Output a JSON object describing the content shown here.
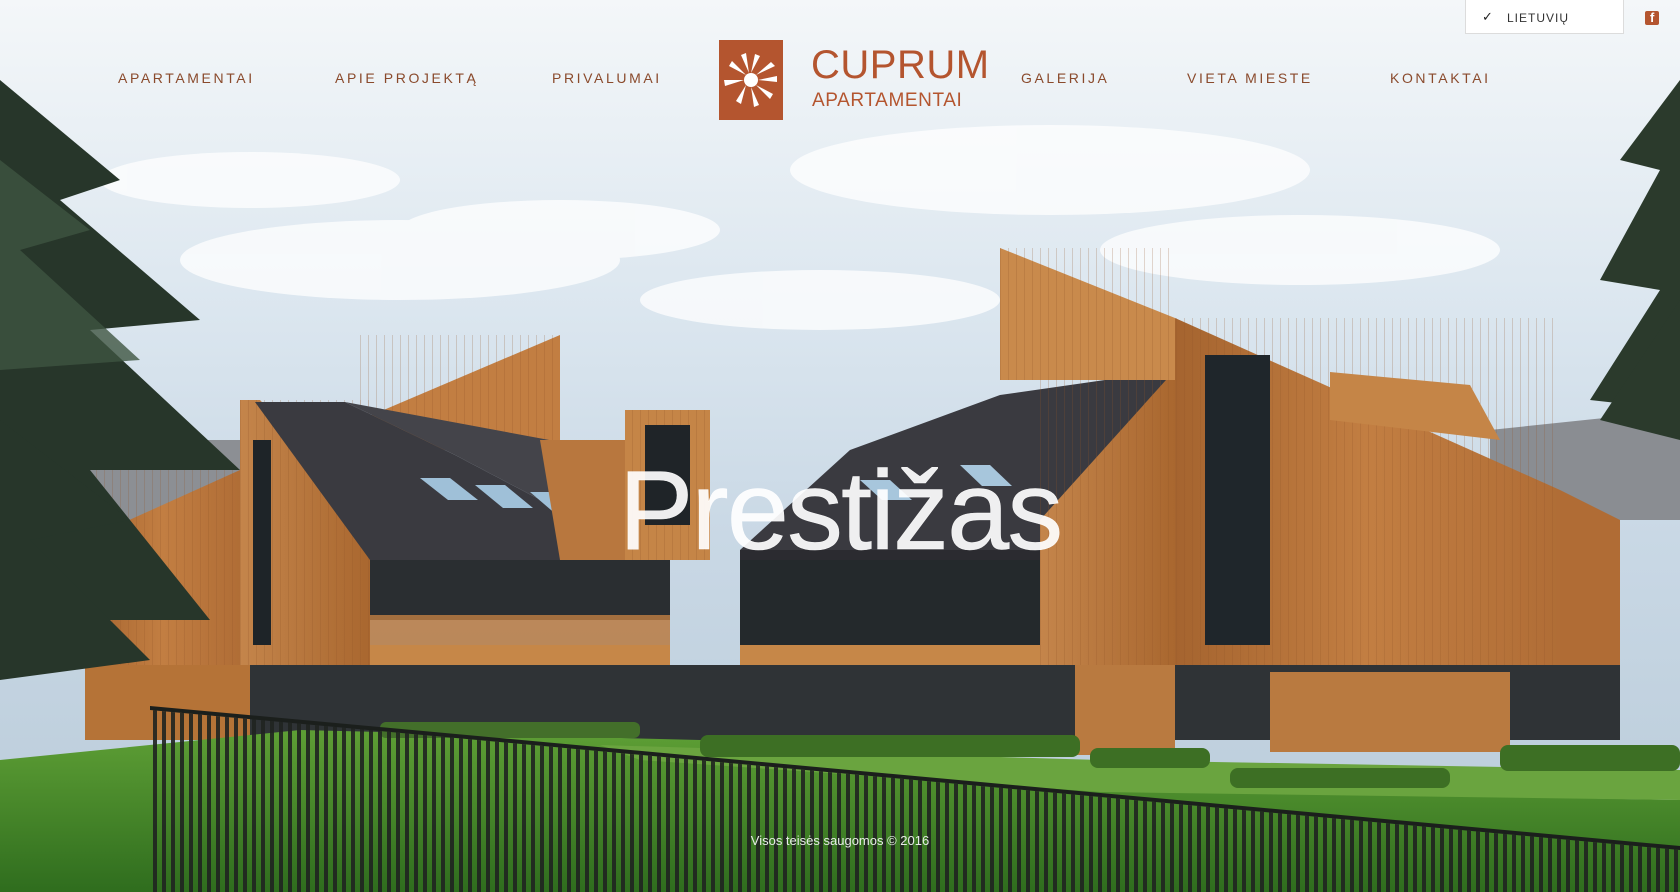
{
  "nav": {
    "left": [
      "APARTAMENTAI",
      "APIE PROJEKTĄ",
      "PRIVALUMAI"
    ],
    "right": [
      "GALERIJA",
      "VIETA MIESTE",
      "KONTAKTAI"
    ]
  },
  "logo": {
    "line1": "CUPRUM",
    "line2": "APARTAMENTAI"
  },
  "language": {
    "check": "✓",
    "selected": "LIETUVIŲ"
  },
  "social": {
    "facebook_icon": "f"
  },
  "hero": {
    "title": "Prestižas"
  },
  "footer": {
    "copyright": "Visos teisės saugomos © 2016"
  },
  "colors": {
    "brand": "#b4552f",
    "nav_text": "#8a4a2c",
    "facade": "#b7763d",
    "roof": "#3a3a40",
    "lawn": "#3f8a2a",
    "sky": "#d6e3ee"
  }
}
